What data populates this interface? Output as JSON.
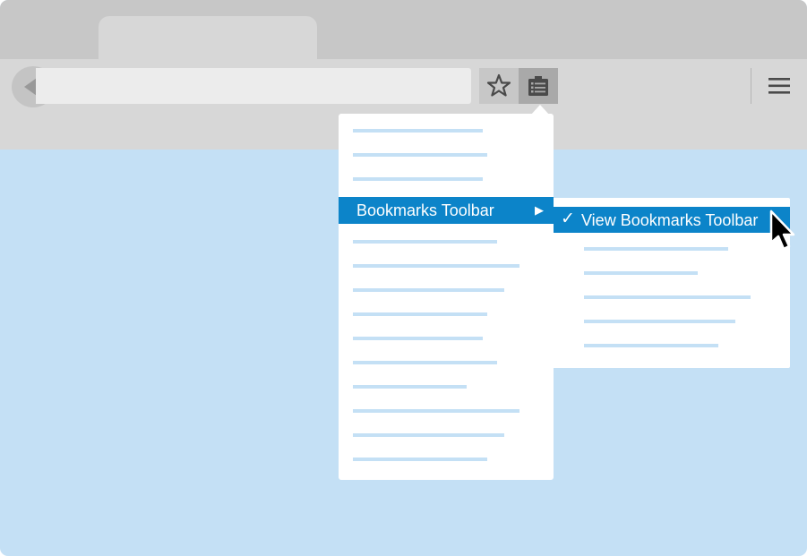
{
  "colors": {
    "content": "#c4e0f5",
    "highlight": "#0c84c9",
    "placeholder_line": "#c4e0f5",
    "chrome": "#d7d7d7",
    "titlebar": "#c7c7c7"
  },
  "navigation": {
    "back_icon": "triangle-left-icon"
  },
  "url_bar": {
    "value": ""
  },
  "toolbar": {
    "bookmark_star_icon": "star-icon",
    "bookmarks_menu_icon": "bookmarks-list-icon",
    "menu_icon": "hamburger-icon"
  },
  "bookmarks_menu": {
    "highlighted_item": {
      "label": "Bookmarks Toolbar",
      "arrow": "▶"
    }
  },
  "submenu": {
    "highlighted_item": {
      "check": "✓",
      "label": "View Bookmarks Toolbar"
    }
  },
  "pointer": {
    "icon": "mouse-pointer-icon"
  }
}
